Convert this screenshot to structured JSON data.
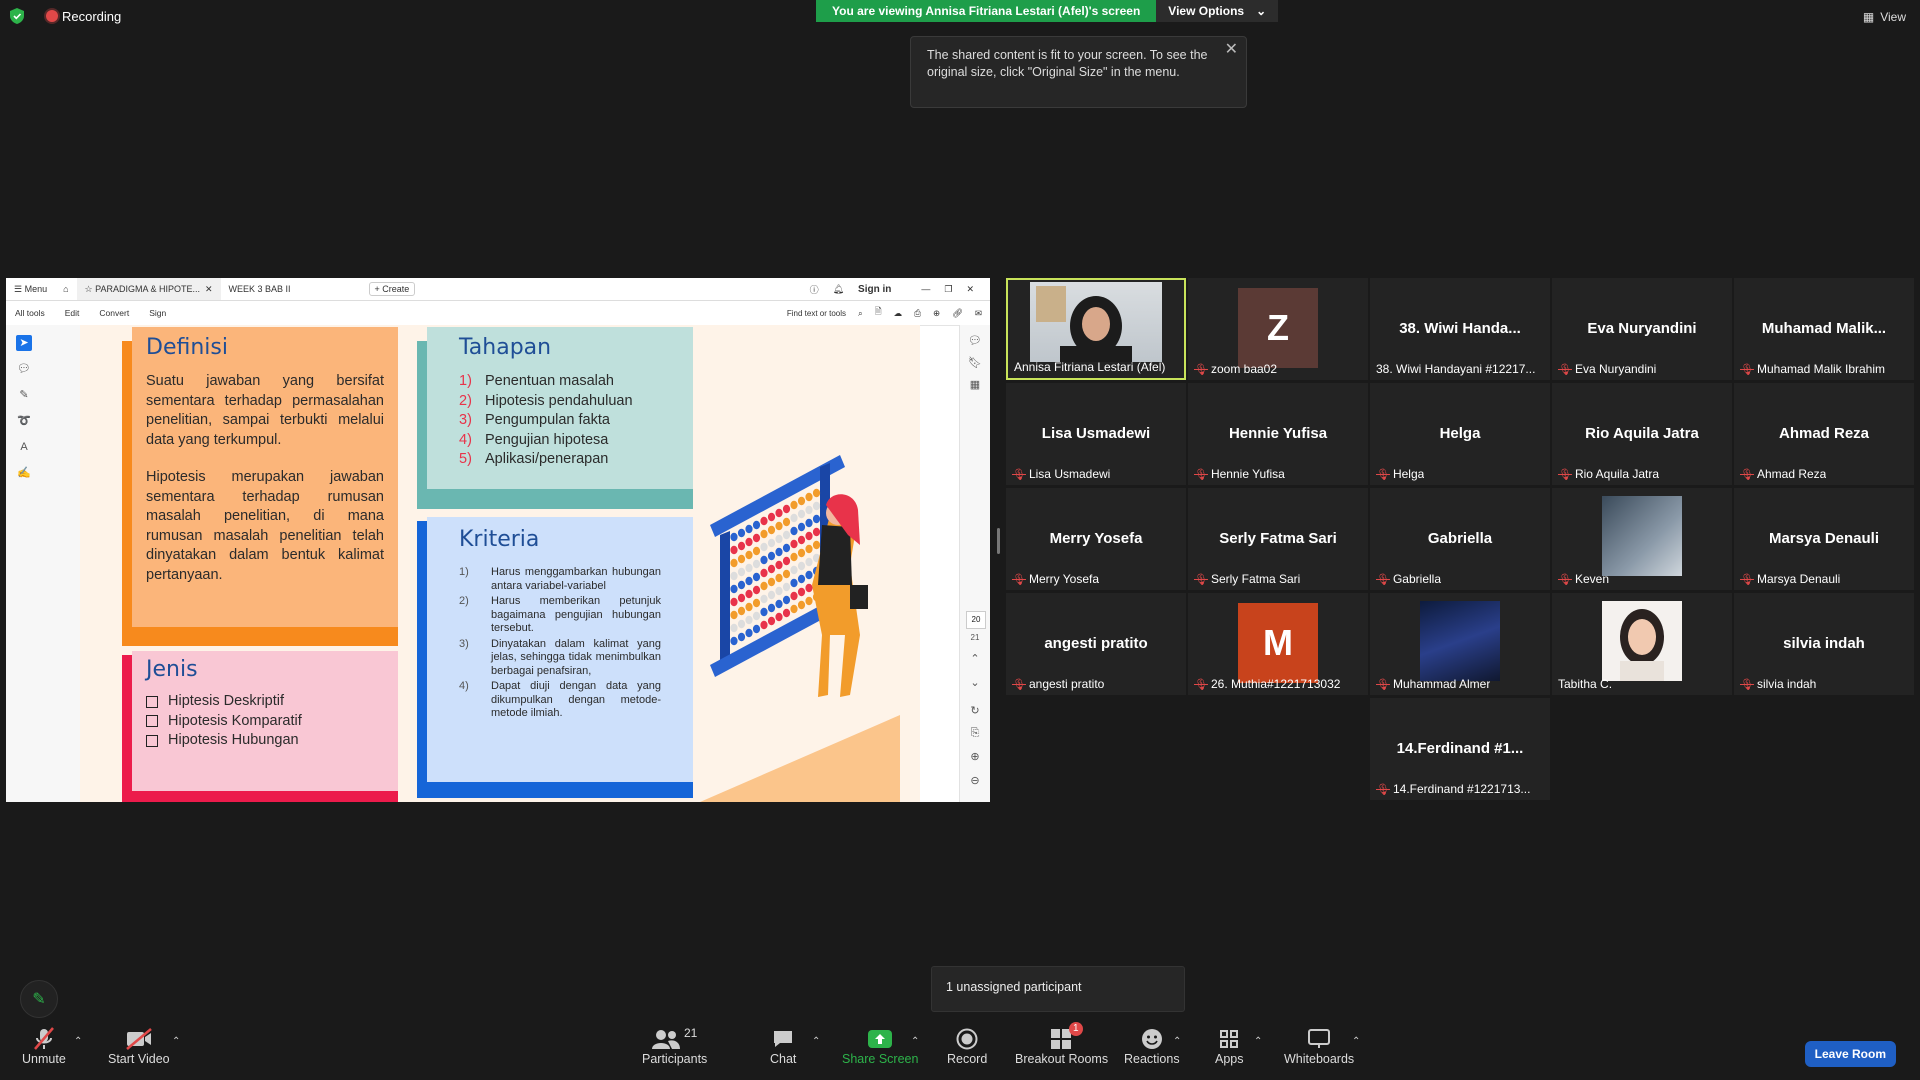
{
  "topbar": {
    "recording": "Recording",
    "viewing": "You are viewing Annisa Fitriana Lestari (Afel)'s screen",
    "view_options": "View Options",
    "view": "View",
    "tip": "The shared content is fit to your screen. To see the original size, click \"Original Size\" in the menu."
  },
  "pdf": {
    "menu": "Menu",
    "tab1": "PARADIGMA & HIPOTE...",
    "tab2": "WEEK 3 BAB II",
    "create": "+ Create",
    "sign_in": "Sign in",
    "tools": [
      "All tools",
      "Edit",
      "Convert",
      "Sign"
    ],
    "find": "Find text or tools",
    "page_num": "20",
    "page_total": "21"
  },
  "slide": {
    "definisi": {
      "title": "Definisi",
      "p1": "Suatu jawaban yang bersifat sementara terhadap permasalahan penelitian, sampai terbukti melalui data yang terkumpul.",
      "p2": "Hipotesis merupakan jawaban sementara terhadap rumusan masalah penelitian, di mana rumusan masalah penelitian telah dinyatakan dalam bentuk kalimat pertanyaan."
    },
    "tahapan": {
      "title": "Tahapan",
      "items": [
        {
          "n": "1)",
          "t": "Penentuan masalah"
        },
        {
          "n": "2)",
          "t": "Hipotesis pendahuluan"
        },
        {
          "n": "3)",
          "t": "Pengumpulan fakta"
        },
        {
          "n": "4)",
          "t": "Pengujian hipotesa"
        },
        {
          "n": "5)",
          "t": "Aplikasi/penerapan"
        }
      ]
    },
    "kriteria": {
      "title": "Kriteria",
      "items": [
        {
          "n": "1)",
          "t": "Harus menggambarkan hubungan antara variabel-variabel"
        },
        {
          "n": "2)",
          "t": "Harus memberikan petunjuk bagaimana pengujian hubungan tersebut."
        },
        {
          "n": "3)",
          "t": "Dinyatakan dalam kalimat yang jelas, sehingga tidak menimbulkan berbagai penafsiran,"
        },
        {
          "n": "4)",
          "t": "Dapat diuji dengan data yang dikumpulkan dengan metode-metode ilmiah."
        }
      ]
    },
    "jenis": {
      "title": "Jenis",
      "items": [
        "Hiptesis Deskriptif",
        "Hipotesis Komparatif",
        "Hipotesis Hubungan"
      ]
    }
  },
  "participants": [
    {
      "center": "",
      "label": "Annisa Fitriana Lestari (Afel)",
      "muted": false,
      "kind": "video"
    },
    {
      "center": "Z",
      "label": "zoom baa02",
      "muted": true,
      "kind": "avatar",
      "color": "#5b3a35"
    },
    {
      "center": "38. Wiwi Handa...",
      "label": "38. Wiwi Handayani #12217...",
      "muted": false,
      "kind": "name"
    },
    {
      "center": "Eva Nuryandini",
      "label": "Eva Nuryandini",
      "muted": true,
      "kind": "name"
    },
    {
      "center": "Muhamad Malik...",
      "label": "Muhamad Malik Ibrahim",
      "muted": true,
      "kind": "name"
    },
    {
      "center": "Lisa Usmadewi",
      "label": "Lisa Usmadewi",
      "muted": true,
      "kind": "name"
    },
    {
      "center": "Hennie Yufisa",
      "label": "Hennie Yufisa",
      "muted": true,
      "kind": "name"
    },
    {
      "center": "Helga",
      "label": "Helga",
      "muted": true,
      "kind": "name"
    },
    {
      "center": "Rio Aquila Jatra",
      "label": "Rio Aquila Jatra",
      "muted": true,
      "kind": "name"
    },
    {
      "center": "Ahmad Reza",
      "label": "Ahmad Reza",
      "muted": true,
      "kind": "name"
    },
    {
      "center": "Merry Yosefa",
      "label": "Merry Yosefa",
      "muted": true,
      "kind": "name"
    },
    {
      "center": "Serly Fatma Sari",
      "label": "Serly Fatma Sari",
      "muted": true,
      "kind": "name"
    },
    {
      "center": "Gabriella",
      "label": "Gabriella",
      "muted": true,
      "kind": "name"
    },
    {
      "center": "",
      "label": "Keven",
      "muted": true,
      "kind": "photo-street"
    },
    {
      "center": "Marsya Denauli",
      "label": "Marsya Denauli",
      "muted": true,
      "kind": "name"
    },
    {
      "center": "angesti pratito",
      "label": "angesti pratito",
      "muted": true,
      "kind": "name"
    },
    {
      "center": "M",
      "label": "26. Muthia#1221713032",
      "muted": true,
      "kind": "avatar",
      "color": "#c8431c"
    },
    {
      "center": "",
      "label": "Muhammad Almer",
      "muted": true,
      "kind": "photo-dark"
    },
    {
      "center": "",
      "label": "Tabitha C.",
      "muted": false,
      "kind": "photo-face"
    },
    {
      "center": "silvia indah",
      "label": "silvia indah",
      "muted": true,
      "kind": "name"
    },
    {
      "center": "14.Ferdinand #1...",
      "label": "14.Ferdinand #1221713...",
      "muted": true,
      "kind": "name"
    }
  ],
  "bottom": {
    "unassigned": "1 unassigned participant",
    "unmute": "Unmute",
    "start_video": "Start Video",
    "participants": "Participants",
    "participants_count": "21",
    "chat": "Chat",
    "share_screen": "Share Screen",
    "record": "Record",
    "breakout": "Breakout Rooms",
    "breakout_badge": "1",
    "reactions": "Reactions",
    "apps": "Apps",
    "whiteboards": "Whiteboards",
    "leave": "Leave Room"
  }
}
